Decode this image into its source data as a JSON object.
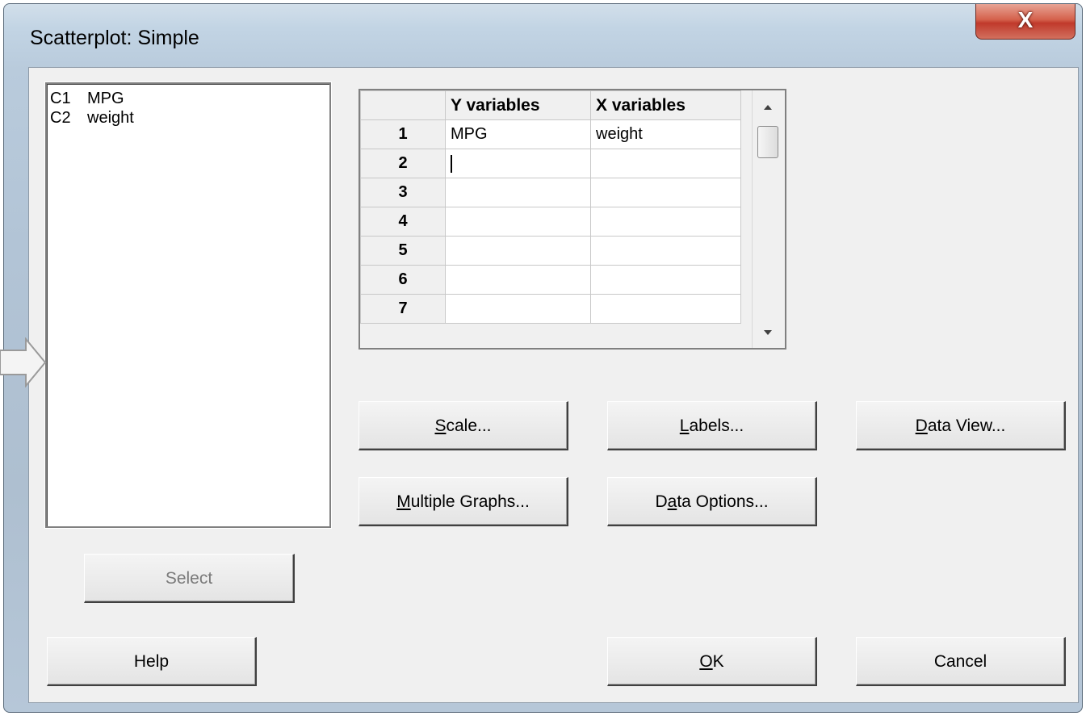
{
  "window": {
    "title": "Scatterplot: Simple",
    "close_glyph": "X"
  },
  "variables": [
    {
      "column": "C1",
      "name": "MPG"
    },
    {
      "column": "C2",
      "name": "weight"
    }
  ],
  "select_label": "Select",
  "grid": {
    "headers": {
      "y": "Y variables",
      "x": "X variables"
    },
    "rows": [
      {
        "num": "1",
        "y": "MPG",
        "x": "weight"
      },
      {
        "num": "2",
        "y": "",
        "x": ""
      },
      {
        "num": "3",
        "y": "",
        "x": ""
      },
      {
        "num": "4",
        "y": "",
        "x": ""
      },
      {
        "num": "5",
        "y": "",
        "x": ""
      },
      {
        "num": "6",
        "y": "",
        "x": ""
      },
      {
        "num": "7",
        "y": "",
        "x": ""
      }
    ]
  },
  "buttons": {
    "scale": {
      "mnemonic": "S",
      "rest": "cale..."
    },
    "labels": {
      "mnemonic": "L",
      "rest": "abels..."
    },
    "data_view": {
      "mnemonic": "D",
      "rest": "ata View..."
    },
    "multiple_graphs": {
      "mnemonic": "M",
      "rest": "ultiple Graphs..."
    },
    "data_options": {
      "pre": "D",
      "mnemonic": "a",
      "rest": "ta Options..."
    },
    "help": "Help",
    "ok": {
      "mnemonic": "O",
      "rest": "K"
    },
    "cancel": "Cancel"
  }
}
